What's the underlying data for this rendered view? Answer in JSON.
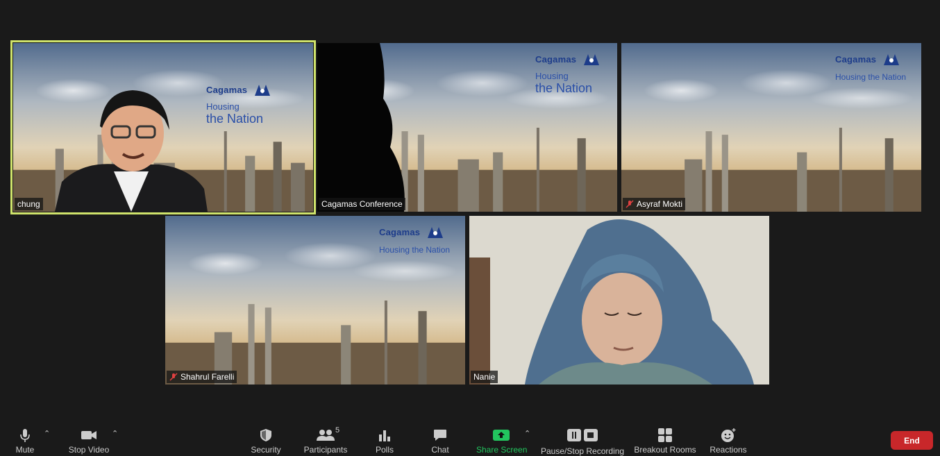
{
  "tiles": [
    {
      "name": "chung",
      "muted": false,
      "active": true
    },
    {
      "name": "Cagamas Conference",
      "muted": false,
      "active": false
    },
    {
      "name": "Asyraf Mokti",
      "muted": true,
      "active": false
    },
    {
      "name": "Shahrul Farelli",
      "muted": true,
      "active": false
    },
    {
      "name": "Nanie",
      "muted": false,
      "active": false
    }
  ],
  "brand": {
    "logo": "Cagamas",
    "tagline_line1": "Housing",
    "tagline_line2": "the Nation",
    "tagline_full": "Housing the Nation"
  },
  "toolbar": {
    "mute": "Mute",
    "stop_video": "Stop Video",
    "security": "Security",
    "participants": "Participants",
    "participants_count": "5",
    "polls": "Polls",
    "chat": "Chat",
    "share_screen": "Share Screen",
    "recording": "Pause/Stop Recording",
    "breakout": "Breakout Rooms",
    "reactions": "Reactions",
    "end": "End"
  },
  "colors": {
    "active_speaker_border": "#cfe36b",
    "share_green": "#22c55e",
    "end_red": "#c8272a",
    "brand_blue": "#1d3c8a"
  }
}
